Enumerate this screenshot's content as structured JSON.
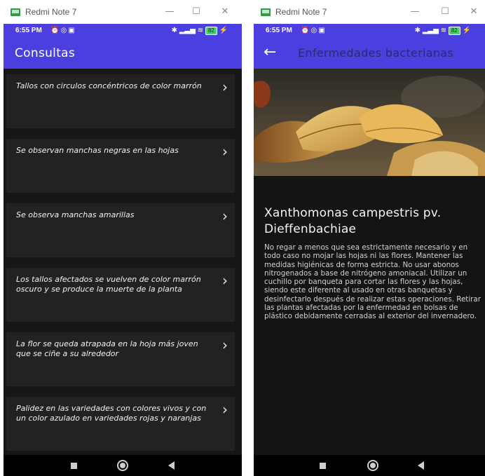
{
  "left_window": {
    "title": "Redmi Note 7",
    "controls": {
      "minimize": "—",
      "maximize": "☐",
      "close": "✕"
    },
    "status": {
      "time": "6:55 PM",
      "battery": "82"
    },
    "appbar_title": "Consultas",
    "items": [
      {
        "text": "Tallos con circulos concéntricos de color marrón"
      },
      {
        "text": "Se observan manchas negras en las hojas"
      },
      {
        "text": "Se observa manchas amarillas"
      },
      {
        "text": "Los tallos afectados se vuelven de color marrón oscuro y se produce la muerte de la planta"
      },
      {
        "text": "La flor se queda atrapada en la hoja más joven que se ciñe a su alrededor"
      },
      {
        "text": "Palidez en las variedades con colores vivos y con un color azulado en variedades rojas y naranjas"
      }
    ],
    "chevron": "›"
  },
  "right_window": {
    "title": "Redmi Note 7",
    "controls": {
      "minimize": "—",
      "maximize": "☐",
      "close": "✕"
    },
    "status": {
      "time": "6:55 PM",
      "battery": "82"
    },
    "back": "←",
    "appbar_title": "Enfermedades bacterianas",
    "disease_title": "Xanthomonas campestris pv. Dieffenbachiae",
    "disease_body": "No regar a menos que sea estrictamente necesario y en todo caso no mojar las hojas ni las flores. Mantener las medidas higiénicas de forma estricta. No usar abonos nitrogenados a base de nitrógeno amoniacal. Utilizar un cuchillo por banqueta para cortar las flores y las hojas, siendo este diferente al usado en otras banquetas y desinfectarlo después de realizar estas operaciones. Retirar las plantas afectadas por la enfermedad en bolsas de plástico debidamente cerradas al exterior del invernadero."
  },
  "colors": {
    "accent": "#4b3fe0",
    "background": "#161616",
    "card": "#222222"
  },
  "icons": [
    "app-icon",
    "alarm-icon",
    "whatsapp-icon",
    "bluetooth-icon",
    "signal-icon",
    "wifi-icon",
    "battery-icon",
    "chevron-right-icon",
    "back-arrow-icon",
    "nav-recents-icon",
    "nav-home-icon",
    "nav-back-icon"
  ]
}
